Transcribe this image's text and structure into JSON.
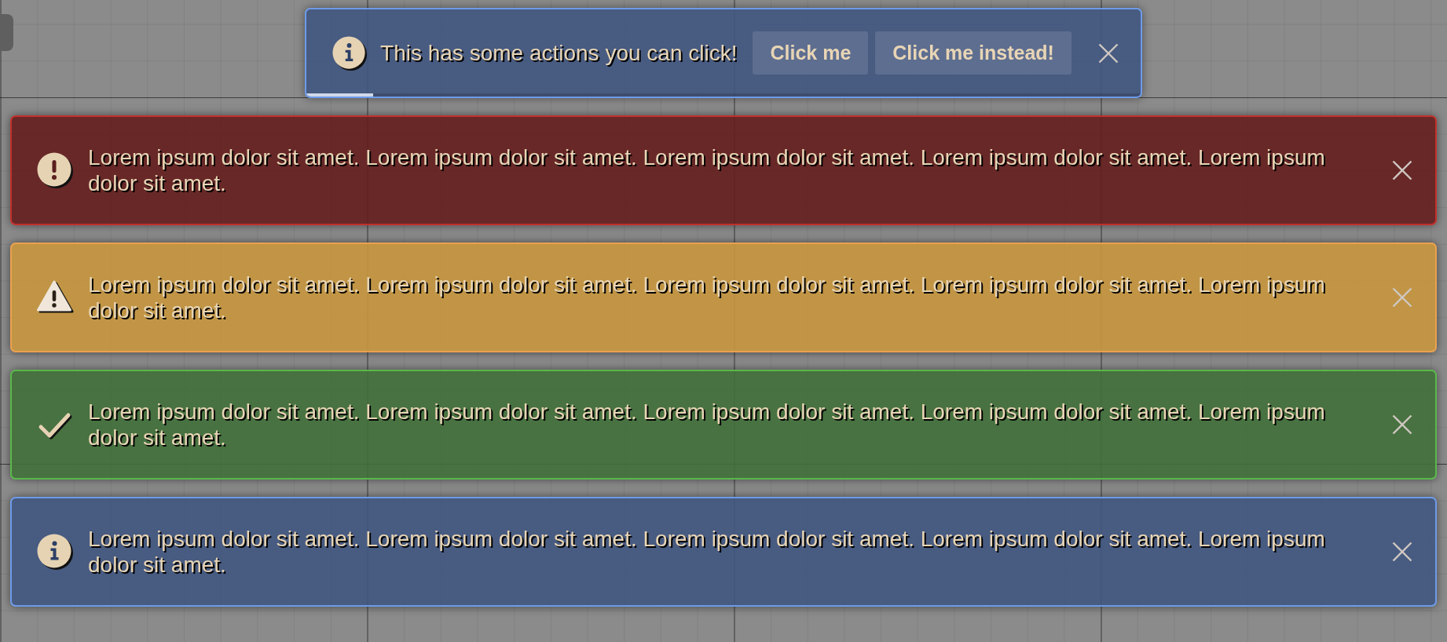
{
  "toast": {
    "kind": "info",
    "message": "This has some actions you can click!",
    "actions": [
      "Click me",
      "Click me instead!"
    ],
    "progress": {
      "level": 0.08
    }
  },
  "alerts": [
    {
      "kind": "error",
      "message": "Lorem ipsum dolor sit amet. Lorem ipsum dolor sit amet. Lorem ipsum dolor sit amet. Lorem ipsum dolor sit amet. Lorem ipsum dolor sit amet."
    },
    {
      "kind": "warning",
      "message": "Lorem ipsum dolor sit amet. Lorem ipsum dolor sit amet. Lorem ipsum dolor sit amet. Lorem ipsum dolor sit amet. Lorem ipsum dolor sit amet."
    },
    {
      "kind": "success",
      "message": "Lorem ipsum dolor sit amet. Lorem ipsum dolor sit amet. Lorem ipsum dolor sit amet. Lorem ipsum dolor sit amet. Lorem ipsum dolor sit amet."
    },
    {
      "kind": "info",
      "message": "Lorem ipsum dolor sit amet. Lorem ipsum dolor sit amet. Lorem ipsum dolor sit amet. Lorem ipsum dolor sit amet. Lorem ipsum dolor sit amet."
    }
  ]
}
